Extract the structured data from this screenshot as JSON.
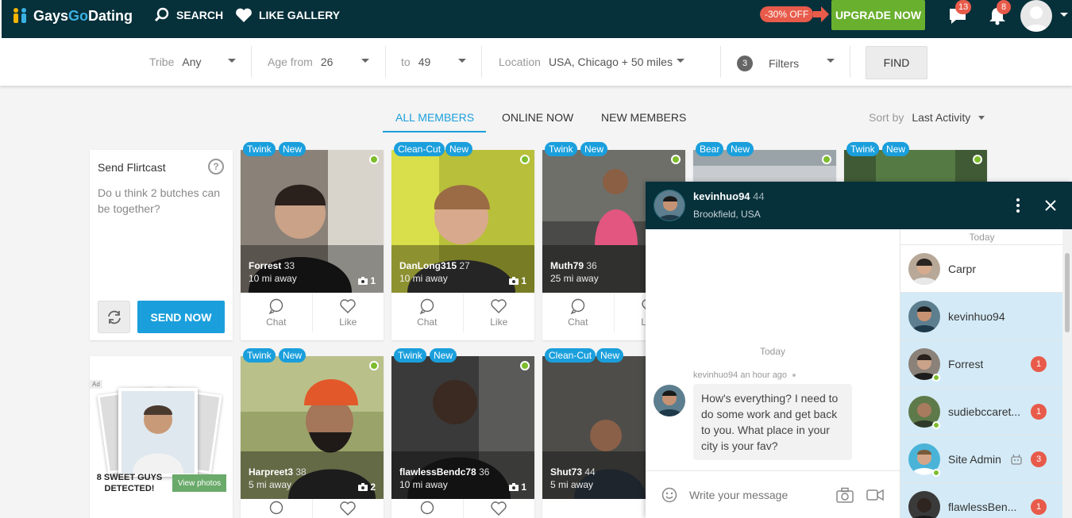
{
  "header": {
    "logo_gays": "Gays",
    "logo_go": "Go",
    "logo_dating": "Dating",
    "search_label": "SEARCH",
    "gallery_label": "LIKE GALLERY",
    "discount_label": "-30% OFF",
    "upgrade_label": "UPGRADE NOW",
    "messages_count": "13",
    "notifications_count": "8"
  },
  "filters": {
    "tribe_label": "Tribe",
    "tribe_value": "Any",
    "age_from_label": "Age from",
    "age_from_value": "26",
    "age_to_label": "to",
    "age_to_value": "49",
    "location_label": "Location",
    "location_value": "USA, Chicago + 50 miles",
    "filters_count": "3",
    "filters_label": "Filters",
    "find_label": "FIND"
  },
  "tabs": {
    "all": "ALL MEMBERS",
    "online": "ONLINE NOW",
    "new": "NEW MEMBERS",
    "sort_label": "Sort by",
    "sort_value": "Last Activity"
  },
  "flirtcast": {
    "title": "Send Flirtcast",
    "help": "?",
    "message": "Do u think 2 butches can be together?",
    "send_label": "SEND NOW"
  },
  "ad": {
    "badge": "Ad",
    "headline_1": "8 SWEET GUYS",
    "headline_2": "DETECTED!",
    "button": "View photos"
  },
  "actions": {
    "chat": "Chat",
    "like": "Like"
  },
  "members_row1": [
    {
      "tag": "Twink",
      "new": "New",
      "name": "Forrest",
      "age": "33",
      "distance": "10 mi away",
      "photos": "1"
    },
    {
      "tag": "Clean-Cut",
      "new": "New",
      "name": "DanLong315",
      "age": "27",
      "distance": "10 mi away",
      "photos": "1"
    },
    {
      "tag": "Twink",
      "new": "New",
      "name": "Muth79",
      "age": "36",
      "distance": "25 mi away",
      "photos": ""
    },
    {
      "tag": "Bear",
      "new": "New"
    },
    {
      "tag": "Twink",
      "new": "New"
    }
  ],
  "members_row2": [
    {
      "tag": "Twink",
      "new": "New",
      "name": "Harpreet3",
      "age": "38",
      "distance": "5 mi away",
      "photos": "2"
    },
    {
      "tag": "Twink",
      "new": "New",
      "name": "flawlessBendc78",
      "age": "36",
      "distance": "10 mi away",
      "photos": "1"
    },
    {
      "tag": "Clean-Cut",
      "new": "New",
      "name": "Shut73",
      "age": "44",
      "distance": "5 mi away",
      "photos": ""
    }
  ],
  "chat": {
    "user": "kevinhuo94",
    "age": "44",
    "location": "Brookfield, USA",
    "day_label": "Today",
    "msg_meta": "kevinhuo94 an hour ago",
    "msg_text": "How's everything? I need to do some work and get back to you. What place in your city is your fav?",
    "input_placeholder": "Write your message",
    "list_day": "Today",
    "conversations": [
      {
        "name": "Carpr",
        "unread": ""
      },
      {
        "name": "kevinhuo94",
        "unread": ""
      },
      {
        "name": "Forrest",
        "unread": "1"
      },
      {
        "name": "sudiebccaret...",
        "unread": "1"
      },
      {
        "name": "Site Admin",
        "unread": "3"
      },
      {
        "name": "flawlessBen...",
        "unread": "1"
      }
    ]
  },
  "colors": {
    "nav_bg": "#06303a",
    "accent": "#1a9fdc",
    "upgrade": "#69b02f",
    "badge": "#e85b4a",
    "online": "#7dbd2d"
  }
}
